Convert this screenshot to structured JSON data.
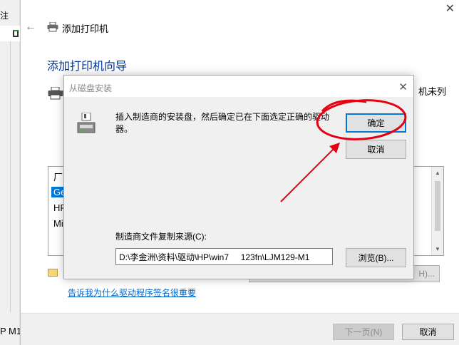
{
  "background_window": {
    "top_text": "注",
    "bottom_text": "P M1"
  },
  "wizard": {
    "title": "添加打印机",
    "heading": "添加打印机向导",
    "side_text": "机未列",
    "list_items": [
      "厂",
      "Ge",
      "HP",
      "Mi"
    ],
    "obscured_button_text": "H)...",
    "signing_link": "告诉我为什么驱动程序签名很重要",
    "next_button": "下一页(N)",
    "cancel_button": "取消"
  },
  "dialog": {
    "title": "从磁盘安装",
    "message": "插入制造商的安装盘，然后确定已在下面选定正确的驱动器。",
    "ok_button": "确定",
    "cancel_button": "取消",
    "path_label": "制造商文件复制来源(C):",
    "path_value": "D:\\李金洲\\资料\\驱动\\HP\\win7     123fn\\LJM129-M1",
    "browse_button": "浏览(B)..."
  },
  "colors": {
    "accent": "#0078d7",
    "heading": "#003399",
    "link": "#0066cc",
    "annotation": "#e60012"
  },
  "icons": [
    "back-arrow-icon",
    "printer-icon",
    "floppy-disk-icon",
    "close-icon",
    "certificate-icon"
  ]
}
